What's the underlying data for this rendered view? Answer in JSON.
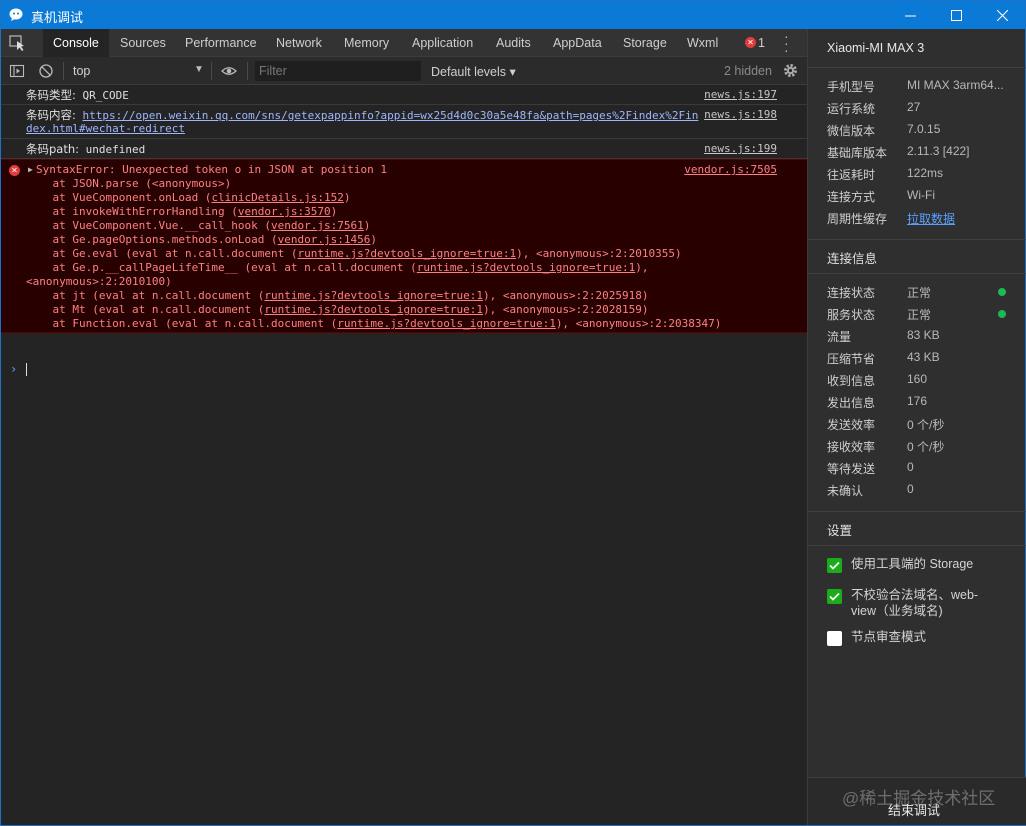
{
  "window": {
    "title": "真机调试",
    "controls": [
      "minimize-icon",
      "maximize-icon",
      "close-icon"
    ]
  },
  "tabs": [
    {
      "label": "Console",
      "active": true
    },
    {
      "label": "Sources"
    },
    {
      "label": "Performance"
    },
    {
      "label": "Network"
    },
    {
      "label": "Memory"
    },
    {
      "label": "Application"
    },
    {
      "label": "Audits"
    },
    {
      "label": "AppData"
    },
    {
      "label": "Storage"
    },
    {
      "label": "Wxml"
    }
  ],
  "error_count": "1",
  "toolbar": {
    "context": "top",
    "filter_placeholder": "Filter",
    "levels": "Default levels ▾",
    "hidden": "2 hidden"
  },
  "console": {
    "messages": [
      {
        "label": "条码类型:",
        "text": " QR_CODE",
        "source": "news.js:197"
      },
      {
        "label": "条码内容:",
        "text_line1": "https://open.weixin.qq.com/sns/getexpappinfo?appid=wx25d4d0c30a5e48fa&path=pages%2Findex%2Fin",
        "text_line2": "dex.html#wechat-redirect",
        "source": "news.js:198"
      },
      {
        "label": "条码path:",
        "text": " undefined",
        "source": "news.js:199"
      }
    ],
    "error": {
      "message": "SyntaxError: Unexpected token o in JSON at position 1",
      "source": "vendor.js:7505",
      "stack": [
        {
          "pre": "    at JSON.parse (<anonymous>)",
          "link": "",
          "post": ""
        },
        {
          "pre": "    at VueComponent.onLoad (",
          "link": "clinicDetails.js:152",
          "post": ")"
        },
        {
          "pre": "    at invokeWithErrorHandling (",
          "link": "vendor.js:3570",
          "post": ")"
        },
        {
          "pre": "    at VueComponent.Vue.__call_hook (",
          "link": "vendor.js:7561",
          "post": ")"
        },
        {
          "pre": "    at Ge.pageOptions.methods.onLoad (",
          "link": "vendor.js:1456",
          "post": ")"
        },
        {
          "pre": "    at Ge.eval (eval at n.call.document (",
          "link": "runtime.js?devtools_ignore=true:1",
          "post": "), <anonymous>:2:2010355)"
        },
        {
          "pre": "    at Ge.p.__callPageLifeTime__ (eval at n.call.document (",
          "link": "runtime.js?devtools_ignore=true:1",
          "post": "),"
        },
        {
          "pre": "<anonymous>:2:2010100)",
          "link": "",
          "post": ""
        },
        {
          "pre": "    at jt (eval at n.call.document (",
          "link": "runtime.js?devtools_ignore=true:1",
          "post": "), <anonymous>:2:2025918)"
        },
        {
          "pre": "    at Mt (eval at n.call.document (",
          "link": "runtime.js?devtools_ignore=true:1",
          "post": "), <anonymous>:2:2028159)"
        },
        {
          "pre": "    at Function.eval (eval at n.call.document (",
          "link": "runtime.js?devtools_ignore=true:1",
          "post": "), <anonymous>:2:2038347)"
        }
      ]
    },
    "prompt": "›"
  },
  "panel": {
    "device": "Xiaomi-MI MAX 3",
    "info": [
      {
        "key": "手机型号",
        "value": "MI MAX 3arm64..."
      },
      {
        "key": "运行系统",
        "value": "27"
      },
      {
        "key": "微信版本",
        "value": "7.0.15"
      },
      {
        "key": "基础库版本",
        "value": "2.11.3 [422]"
      },
      {
        "key": "往返耗时",
        "value": "122ms"
      },
      {
        "key": "连接方式",
        "value": "Wi-Fi"
      },
      {
        "key": "周期性缓存",
        "value": "拉取数据"
      }
    ],
    "connection_title": "连接信息",
    "connection": [
      {
        "key": "连接状态",
        "value": "正常"
      },
      {
        "key": "服务状态",
        "value": "正常"
      },
      {
        "key": "流量",
        "value": "83 KB"
      },
      {
        "key": "压缩节省",
        "value": "43 KB"
      },
      {
        "key": "收到信息",
        "value": "160"
      },
      {
        "key": "发出信息",
        "value": "176"
      },
      {
        "key": "发送效率",
        "value": "0 个/秒"
      },
      {
        "key": "接收效率",
        "value": "0 个/秒"
      },
      {
        "key": "等待发送",
        "value": "0"
      },
      {
        "key": "未确认",
        "value": "0"
      }
    ],
    "settings_title": "设置",
    "settings": [
      {
        "label": "使用工具端的 Storage",
        "checked": true
      },
      {
        "label_line1": "不校验合法域名、web-",
        "label_line2": "view（业务域名)",
        "checked": true
      },
      {
        "label": "节点审查模式",
        "checked": false
      }
    ],
    "end_button": "结束调试",
    "watermark": "@稀土掘金技术社区"
  },
  "colors": {
    "titlebar": "#0a7ad6",
    "error_bg": "#290000",
    "error_text": "#ff8080",
    "status_ok": "#1db954",
    "checkbox_on": "#1aad19"
  }
}
